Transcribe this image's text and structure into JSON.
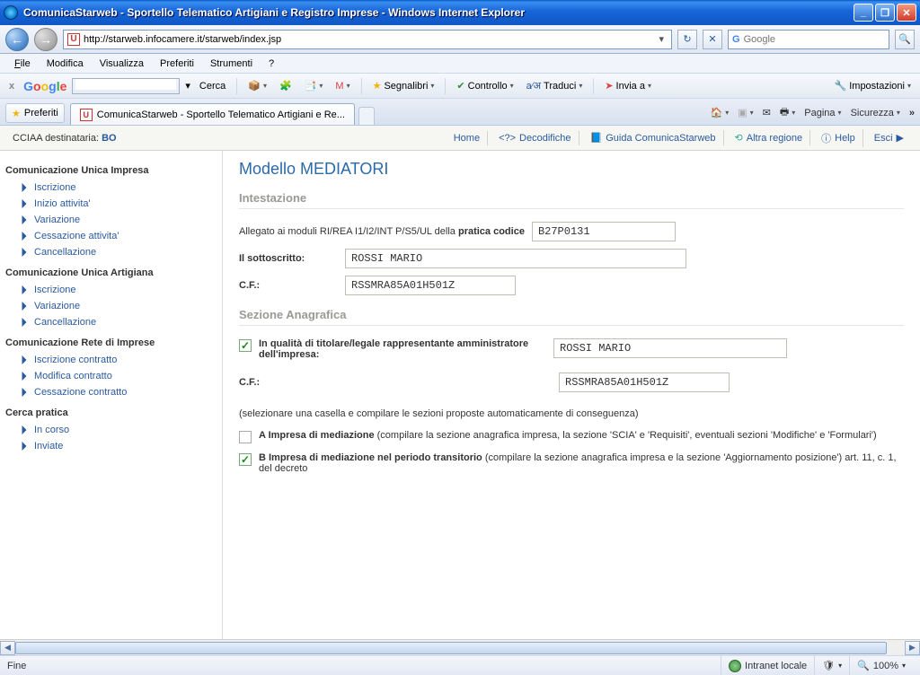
{
  "window": {
    "title": "ComunicaStarweb - Sportello Telematico Artigiani e Registro Imprese - Windows Internet Explorer"
  },
  "address": {
    "url": "http://starweb.infocamere.it/starweb/index.jsp"
  },
  "search": {
    "placeholder": "Google",
    "value": ""
  },
  "menubar": {
    "file": "File",
    "edit": "Modifica",
    "view": "Visualizza",
    "fav": "Preferiti",
    "tools": "Strumenti",
    "help": "?"
  },
  "gtoolbar": {
    "cerca": "Cerca",
    "segnalibri": "Segnalibri",
    "controllo": "Controllo",
    "traduci": "Traduci",
    "invia": "Invia a",
    "impostazioni": "Impostazioni"
  },
  "tabstrip": {
    "fav": "Preferiti",
    "tab_title": "ComunicaStarweb - Sportello Telematico Artigiani e Re...",
    "pagina": "Pagina",
    "sicurezza": "Sicurezza"
  },
  "apptoolbar": {
    "left_prefix": "CCIAA destinataria:",
    "left_value": "BO",
    "home": "Home",
    "decod": "Decodifiche",
    "guida": "Guida ComunicaStarweb",
    "altra": "Altra regione",
    "help": "Help",
    "esci": "Esci"
  },
  "sidebar": {
    "g1": "Comunicazione Unica Impresa",
    "g1_items": [
      "Iscrizione",
      "Inizio attivita'",
      "Variazione",
      "Cessazione attivita'",
      "Cancellazione"
    ],
    "g2": "Comunicazione Unica Artigiana",
    "g2_items": [
      "Iscrizione",
      "Variazione",
      "Cancellazione"
    ],
    "g3": "Comunicazione Rete di Imprese",
    "g3_items": [
      "Iscrizione contratto",
      "Modifica contratto",
      "Cessazione contratto"
    ],
    "g4": "Cerca pratica",
    "g4_items": [
      "In corso",
      "Inviate"
    ]
  },
  "form": {
    "title": "Modello MEDIATORI",
    "sec1": "Intestazione",
    "allegato_pre": "Allegato ai moduli RI/REA I1/I2/INT P/S5/UL della ",
    "allegato_bold": "pratica codice",
    "pratica_codice": "B27P0131",
    "sott_label": "Il sottoscritto:",
    "sott_value": "ROSSI MARIO",
    "cf_label": "C.F.:",
    "cf_value": "RSSMRA85A01H501Z",
    "sec2": "Sezione Anagrafica",
    "qualita_bold": "In qualità di titolare/legale rappresentante amministratore dell'impresa",
    "qualita_value": "ROSSI MARIO",
    "cf2_value": "RSSMRA85A01H501Z",
    "note": "(selezionare una casella e compilare le sezioni proposte automaticamente di conseguenza)",
    "optA_lead": "A Impresa di mediazione",
    "optA_rest": " (compilare la sezione anagrafica impresa, la sezione 'SCIA' e 'Requisiti', eventuali sezioni 'Modifiche' e 'Formulari')",
    "optB_lead": "B Impresa di mediazione nel periodo transitorio",
    "optB_rest": " (compilare la sezione anagrafica impresa e la sezione 'Aggiornamento posizione') art. 11, c. 1, del decreto"
  },
  "statusbar": {
    "left": "Fine",
    "zone": "Intranet locale",
    "zoom": "100%"
  }
}
